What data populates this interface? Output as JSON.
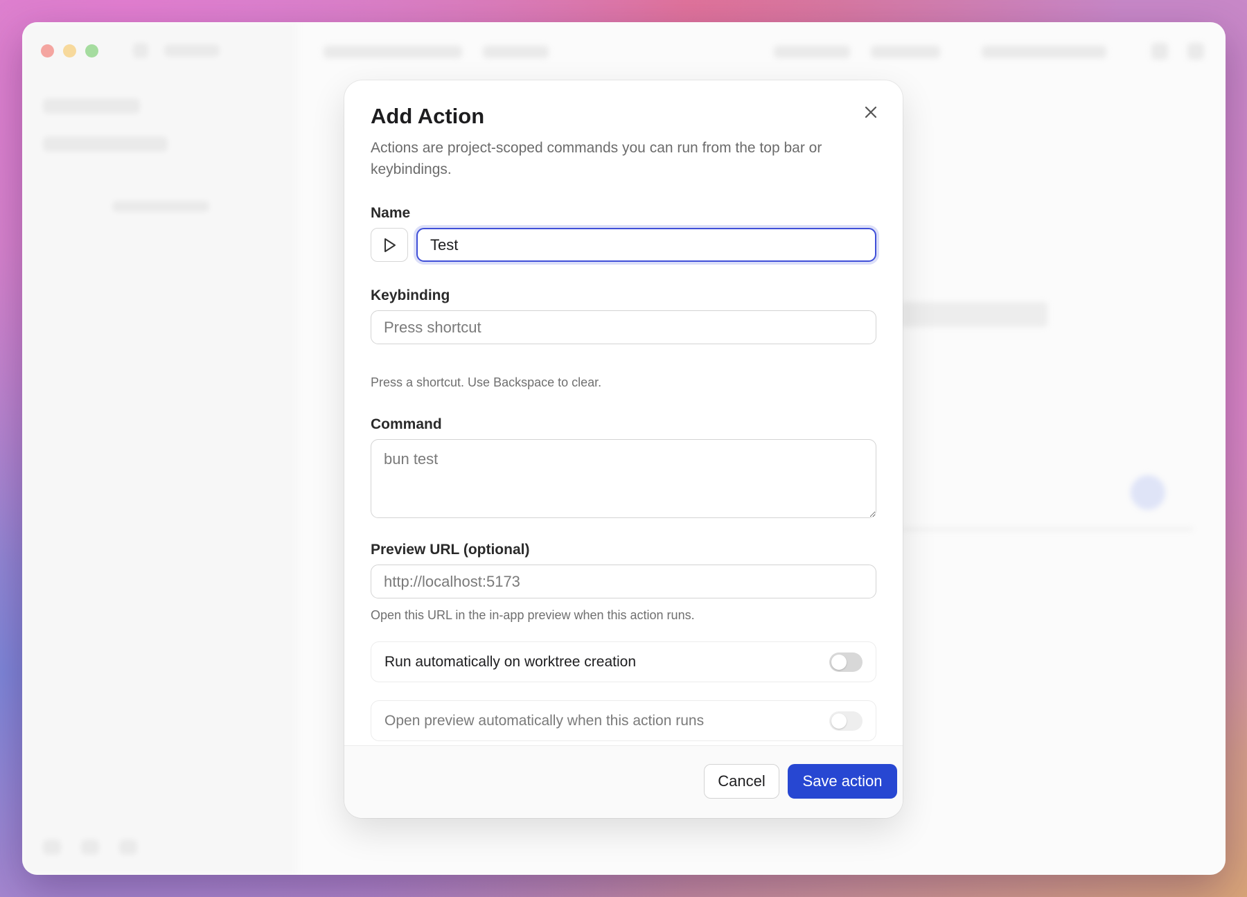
{
  "dialog": {
    "title": "Add Action",
    "description": "Actions are project-scoped commands you can run from the top bar or keybindings.",
    "name_label": "Name",
    "name_value": "Test",
    "name_icon": "play-icon",
    "keybinding_label": "Keybinding",
    "keybinding_placeholder": "Press shortcut",
    "keybinding_hint": "Press a shortcut. Use Backspace to clear.",
    "command_label": "Command",
    "command_placeholder": "bun test",
    "preview_url_label": "Preview URL (optional)",
    "preview_url_placeholder": "http://localhost:5173",
    "preview_url_hint": "Open this URL in the in-app preview when this action runs.",
    "toggle_run_on_worktree": {
      "label": "Run automatically on worktree creation",
      "enabled": false
    },
    "toggle_open_preview": {
      "label": "Open preview automatically when this action runs",
      "enabled": false,
      "disabled": true
    },
    "cancel_label": "Cancel",
    "save_label": "Save action"
  },
  "colors": {
    "accent": "#2747d2",
    "focus_ring": "#3f4fd8"
  }
}
